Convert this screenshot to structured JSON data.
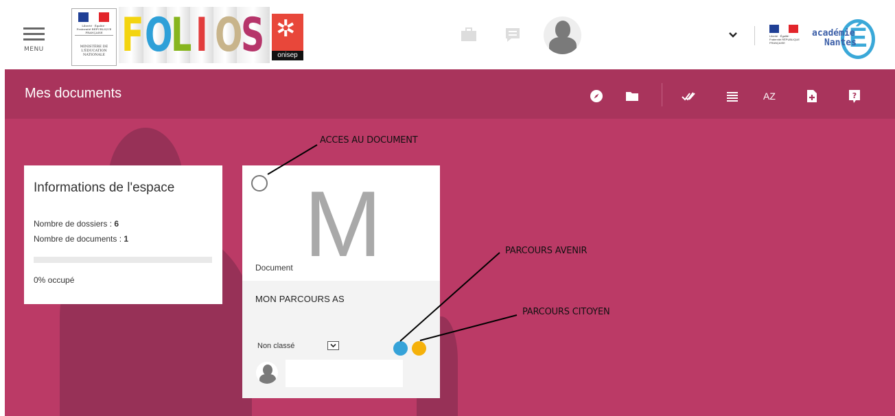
{
  "header": {
    "menu_label": "MENU",
    "ministere_rf": "Liberté · Égalité · Fraternité RÉPUBLIQUE FRANÇAISE",
    "ministere_name": "MINISTÈRE DE L'ÉDUCATION NATIONALE",
    "folios_letters": [
      "F",
      "O",
      "L",
      "I",
      "O",
      "S"
    ],
    "onisep_label": "onisep",
    "rf_small_text": "Liberté · Égalité · Fraternité RÉPUBLIQUE FRANÇAISE",
    "academie_line1": "académie",
    "academie_line2": "Nantes",
    "academie_mark": "É"
  },
  "colors": {
    "main_bg": "#bb3a66",
    "titlebar_bg": "#a9345c",
    "parcours_avenir": "#35a2d8",
    "parcours_citoyen": "#f5b10a",
    "folios_F": "#f3d40f",
    "folios_O1": "#2ea0d8",
    "folios_L": "#87b51e",
    "folios_I": "#e23d3d",
    "folios_O2": "#c8b48b",
    "folios_S": "#b6356a"
  },
  "toolbar": {
    "title": "Mes documents",
    "icons": [
      "compass-icon",
      "folder-icon",
      "double-check-icon",
      "list-icon",
      "sort-az-icon",
      "add-file-icon",
      "help-icon"
    ],
    "sort_label": "AZ"
  },
  "info": {
    "title": "Informations de l'espace",
    "folders_label": "Nombre de dossiers : ",
    "folders_count": "6",
    "documents_label": "Nombre de documents : ",
    "documents_count": "1",
    "usage_fraction": 0,
    "usage_text": "0% occupé"
  },
  "document": {
    "initial": "M",
    "type": "Document",
    "title": "MON PARCOURS AS",
    "classification": "Non classé"
  },
  "annotations": {
    "access": "ACCES AU DOCUMENT",
    "avenir": "PARCOURS AVENIR",
    "citoyen": "PARCOURS CITOYEN"
  }
}
